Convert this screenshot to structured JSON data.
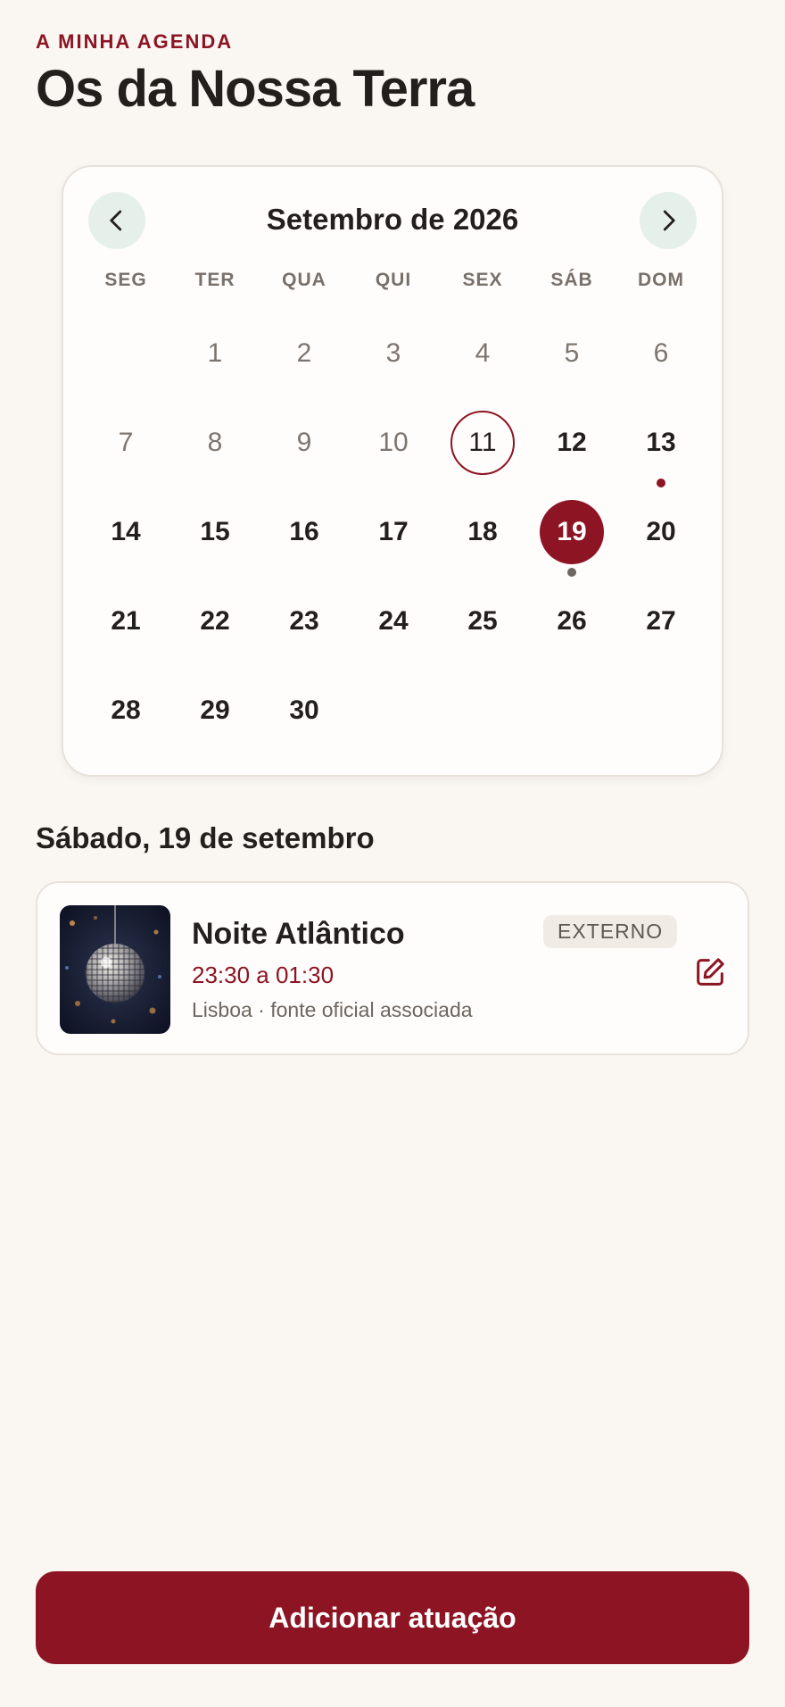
{
  "header": {
    "eyebrow": "A MINHA AGENDA",
    "title": "Os da Nossa Terra"
  },
  "calendar": {
    "month_label": "Setembro de 2026",
    "weekdays": [
      "SEG",
      "TER",
      "QUA",
      "QUI",
      "SEX",
      "SÁB",
      "DOM"
    ],
    "first_weekday_index": 1,
    "days_in_month": 30,
    "today": 11,
    "selected": 19,
    "past_through": 10,
    "event_dots": [
      {
        "day": 13,
        "color": "#8c1423"
      },
      {
        "day": 19,
        "color": "#6e6660"
      }
    ]
  },
  "selected_day": {
    "heading": "Sábado, 19 de setembro"
  },
  "events": [
    {
      "name": "Noite Atlântico",
      "time": "23:30 a 01:30",
      "meta": "Lisboa · fonte oficial associada",
      "badge": "EXTERNO",
      "thumbnail": "disco-ball-image"
    }
  ],
  "actions": {
    "add_label": "Adicionar atuação"
  },
  "colors": {
    "accent": "#8c1423",
    "background": "#faf7f3",
    "nav_button": "#e6f0ea"
  }
}
